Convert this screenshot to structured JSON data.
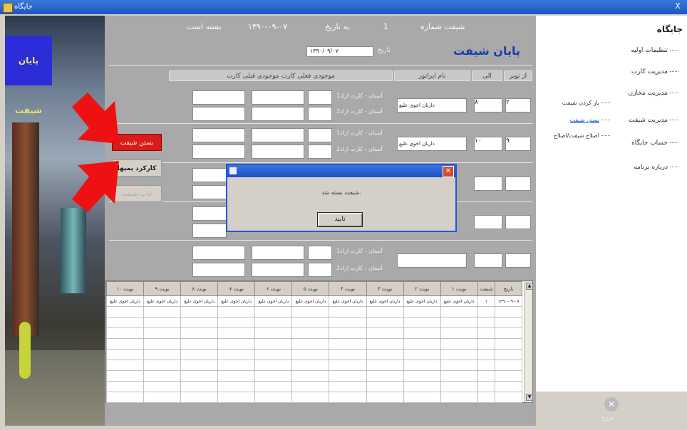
{
  "window": {
    "title": "جایگاه",
    "close_glyph": "X"
  },
  "photo": {
    "sign_text": "پایان شیفت"
  },
  "header": {
    "shift_number_label": "شیفت شماره",
    "shift_number": "1",
    "date_label": "به تاریخ",
    "date": "۱۳۹۰-۰۹-۰۷",
    "status": "بسته است",
    "heading": "پایان شیفت",
    "date_field_label": "تاریخ",
    "date_field_value": "۱۳۹۰/۰۹/۰۷"
  },
  "form": {
    "columns": [
      "از نوبر",
      "الی",
      "نام اپراتور",
      "موجودی قبلی کارت",
      "موجودی فعلی کارت"
    ],
    "row_caption_1": "آستان - کارت ازاد1",
    "row_caption_2": "آستان - کارت ازاد2",
    "rows": [
      {
        "from": "۲",
        "to": "۸",
        "operator": "داریان اخوی علیع"
      },
      {
        "from": "۹",
        "to": "۱۰",
        "operator": "داریان اخوی علیع"
      }
    ]
  },
  "buttons": {
    "close_shift": "بستن شیفت",
    "save": "کارکرد پمپها",
    "print": "چاپ شیفت"
  },
  "sidebar": {
    "title": "جایگاه",
    "items": [
      "تنظیمات اولیه",
      "مدیریت کارت",
      "مدیریت مخازن",
      "مدیریت شیفت",
      "حساب جایگاه",
      "درباره برنامه"
    ],
    "sub_items": [
      "باز کردن شیفت",
      "بستن شیفت",
      "اصلاح شیفت/اصلاح"
    ],
    "exit_label": "خروج"
  },
  "grid": {
    "columns": [
      "تاریخ",
      "شیفت",
      "نوبت ۱",
      "نوبت ۲",
      "نوبت ۳",
      "نوبت ۴",
      "نوبت ۵",
      "نوبت ۶",
      "نوبت ۷",
      "نوبت ۸",
      "نوبت ۹",
      "نوبت ۱۰"
    ],
    "row": [
      "۱۳۹۰-۰۹-۰۷",
      "۱",
      "داریان اخوی علیع",
      "داریان اخوی علیع",
      "داریان اخوی علیع",
      "داریان اخوی علیع",
      "داریان اخوی علیع",
      "داریان اخوی علیع",
      "داریان اخوی علیع",
      "داریان اخوی علیع",
      "داریان اخوی علیع",
      "داریان اخوی علیع"
    ]
  },
  "dialog": {
    "message": "شیفت بسته شد.",
    "ok_label": "تایید"
  },
  "colors": {
    "arrow": "#ee1111",
    "accent_blue": "#1b50c4",
    "close_shift_bg": "#d81c1c"
  }
}
